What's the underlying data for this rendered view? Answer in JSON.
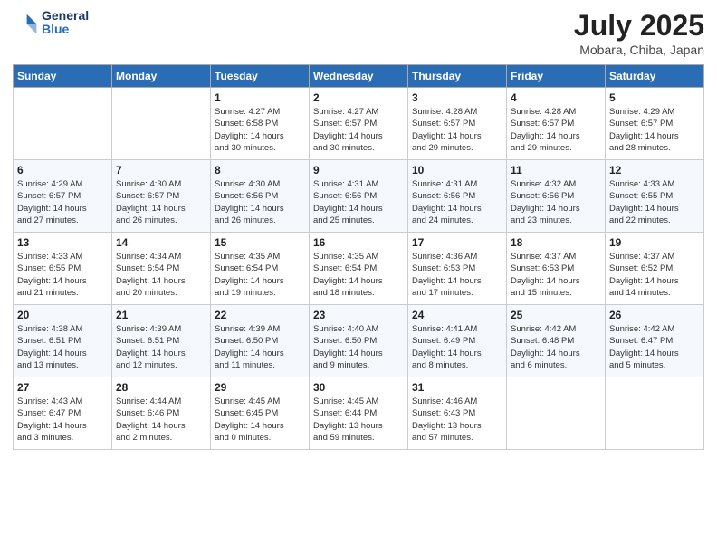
{
  "header": {
    "logo_line1": "General",
    "logo_line2": "Blue",
    "month": "July 2025",
    "location": "Mobara, Chiba, Japan"
  },
  "weekdays": [
    "Sunday",
    "Monday",
    "Tuesday",
    "Wednesday",
    "Thursday",
    "Friday",
    "Saturday"
  ],
  "weeks": [
    [
      {
        "day": "",
        "info": ""
      },
      {
        "day": "",
        "info": ""
      },
      {
        "day": "1",
        "info": "Sunrise: 4:27 AM\nSunset: 6:58 PM\nDaylight: 14 hours\nand 30 minutes."
      },
      {
        "day": "2",
        "info": "Sunrise: 4:27 AM\nSunset: 6:57 PM\nDaylight: 14 hours\nand 30 minutes."
      },
      {
        "day": "3",
        "info": "Sunrise: 4:28 AM\nSunset: 6:57 PM\nDaylight: 14 hours\nand 29 minutes."
      },
      {
        "day": "4",
        "info": "Sunrise: 4:28 AM\nSunset: 6:57 PM\nDaylight: 14 hours\nand 29 minutes."
      },
      {
        "day": "5",
        "info": "Sunrise: 4:29 AM\nSunset: 6:57 PM\nDaylight: 14 hours\nand 28 minutes."
      }
    ],
    [
      {
        "day": "6",
        "info": "Sunrise: 4:29 AM\nSunset: 6:57 PM\nDaylight: 14 hours\nand 27 minutes."
      },
      {
        "day": "7",
        "info": "Sunrise: 4:30 AM\nSunset: 6:57 PM\nDaylight: 14 hours\nand 26 minutes."
      },
      {
        "day": "8",
        "info": "Sunrise: 4:30 AM\nSunset: 6:56 PM\nDaylight: 14 hours\nand 26 minutes."
      },
      {
        "day": "9",
        "info": "Sunrise: 4:31 AM\nSunset: 6:56 PM\nDaylight: 14 hours\nand 25 minutes."
      },
      {
        "day": "10",
        "info": "Sunrise: 4:31 AM\nSunset: 6:56 PM\nDaylight: 14 hours\nand 24 minutes."
      },
      {
        "day": "11",
        "info": "Sunrise: 4:32 AM\nSunset: 6:56 PM\nDaylight: 14 hours\nand 23 minutes."
      },
      {
        "day": "12",
        "info": "Sunrise: 4:33 AM\nSunset: 6:55 PM\nDaylight: 14 hours\nand 22 minutes."
      }
    ],
    [
      {
        "day": "13",
        "info": "Sunrise: 4:33 AM\nSunset: 6:55 PM\nDaylight: 14 hours\nand 21 minutes."
      },
      {
        "day": "14",
        "info": "Sunrise: 4:34 AM\nSunset: 6:54 PM\nDaylight: 14 hours\nand 20 minutes."
      },
      {
        "day": "15",
        "info": "Sunrise: 4:35 AM\nSunset: 6:54 PM\nDaylight: 14 hours\nand 19 minutes."
      },
      {
        "day": "16",
        "info": "Sunrise: 4:35 AM\nSunset: 6:54 PM\nDaylight: 14 hours\nand 18 minutes."
      },
      {
        "day": "17",
        "info": "Sunrise: 4:36 AM\nSunset: 6:53 PM\nDaylight: 14 hours\nand 17 minutes."
      },
      {
        "day": "18",
        "info": "Sunrise: 4:37 AM\nSunset: 6:53 PM\nDaylight: 14 hours\nand 15 minutes."
      },
      {
        "day": "19",
        "info": "Sunrise: 4:37 AM\nSunset: 6:52 PM\nDaylight: 14 hours\nand 14 minutes."
      }
    ],
    [
      {
        "day": "20",
        "info": "Sunrise: 4:38 AM\nSunset: 6:51 PM\nDaylight: 14 hours\nand 13 minutes."
      },
      {
        "day": "21",
        "info": "Sunrise: 4:39 AM\nSunset: 6:51 PM\nDaylight: 14 hours\nand 12 minutes."
      },
      {
        "day": "22",
        "info": "Sunrise: 4:39 AM\nSunset: 6:50 PM\nDaylight: 14 hours\nand 11 minutes."
      },
      {
        "day": "23",
        "info": "Sunrise: 4:40 AM\nSunset: 6:50 PM\nDaylight: 14 hours\nand 9 minutes."
      },
      {
        "day": "24",
        "info": "Sunrise: 4:41 AM\nSunset: 6:49 PM\nDaylight: 14 hours\nand 8 minutes."
      },
      {
        "day": "25",
        "info": "Sunrise: 4:42 AM\nSunset: 6:48 PM\nDaylight: 14 hours\nand 6 minutes."
      },
      {
        "day": "26",
        "info": "Sunrise: 4:42 AM\nSunset: 6:47 PM\nDaylight: 14 hours\nand 5 minutes."
      }
    ],
    [
      {
        "day": "27",
        "info": "Sunrise: 4:43 AM\nSunset: 6:47 PM\nDaylight: 14 hours\nand 3 minutes."
      },
      {
        "day": "28",
        "info": "Sunrise: 4:44 AM\nSunset: 6:46 PM\nDaylight: 14 hours\nand 2 minutes."
      },
      {
        "day": "29",
        "info": "Sunrise: 4:45 AM\nSunset: 6:45 PM\nDaylight: 14 hours\nand 0 minutes."
      },
      {
        "day": "30",
        "info": "Sunrise: 4:45 AM\nSunset: 6:44 PM\nDaylight: 13 hours\nand 59 minutes."
      },
      {
        "day": "31",
        "info": "Sunrise: 4:46 AM\nSunset: 6:43 PM\nDaylight: 13 hours\nand 57 minutes."
      },
      {
        "day": "",
        "info": ""
      },
      {
        "day": "",
        "info": ""
      }
    ]
  ]
}
